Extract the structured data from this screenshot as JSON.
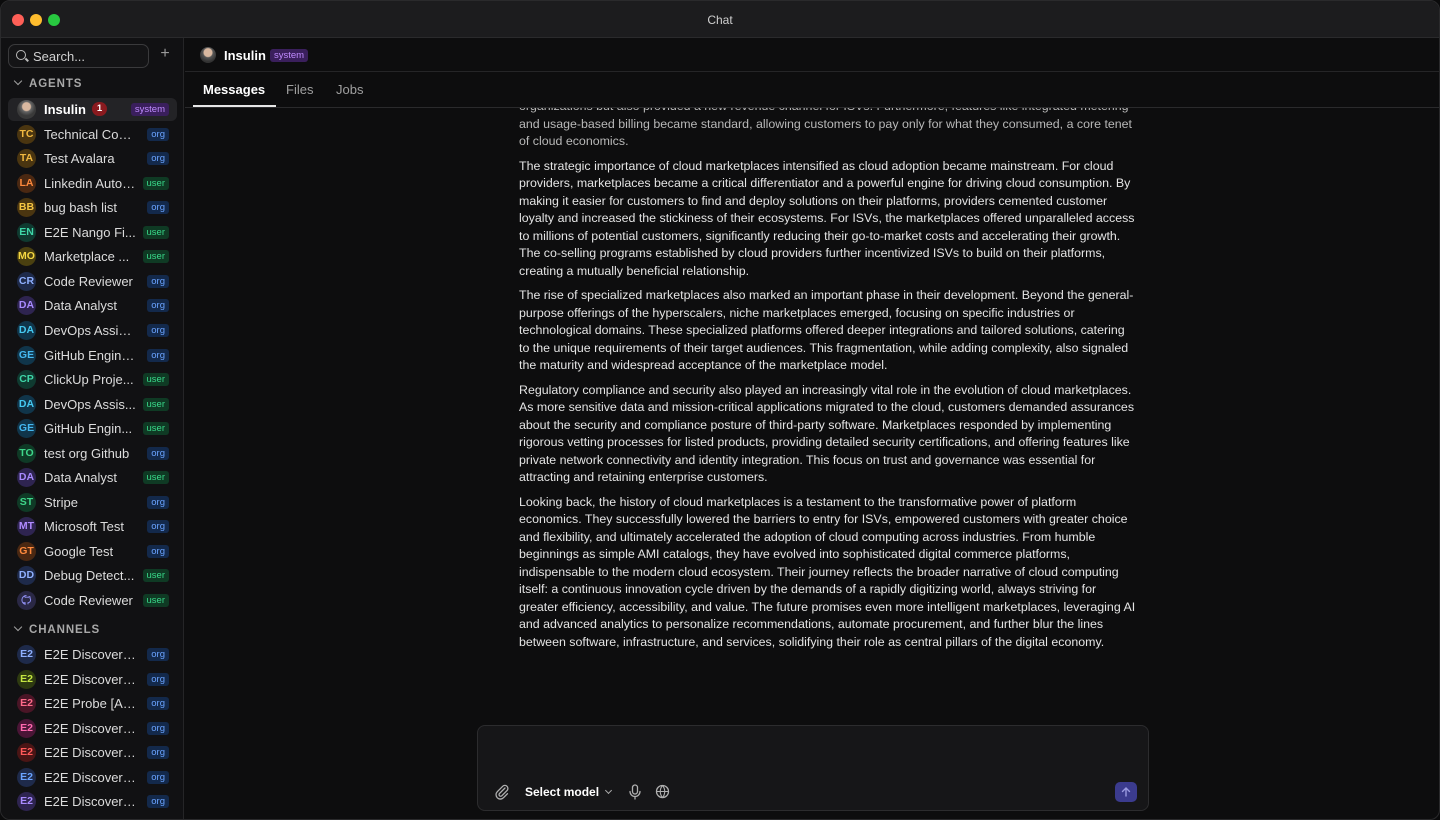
{
  "window": {
    "title": "Chat"
  },
  "sidebar": {
    "search_placeholder": "Search...",
    "agents_heading": "AGENTS",
    "channels_heading": "CHANNELS",
    "agents": [
      {
        "initials": "",
        "name": "Insulin",
        "badge": "system",
        "count": "1",
        "avatar_color": "#555555",
        "text_color": "#ffffff"
      },
      {
        "initials": "TC",
        "name": "Technical Con...",
        "badge": "org",
        "avatar_color": "#4a3510",
        "text_color": "#f0b840"
      },
      {
        "initials": "TA",
        "name": "Test Avalara",
        "badge": "org",
        "avatar_color": "#4a3510",
        "text_color": "#f0b840"
      },
      {
        "initials": "LA",
        "name": "Linkedin Auto ...",
        "badge": "user",
        "avatar_color": "#4a2812",
        "text_color": "#ff8a3d"
      },
      {
        "initials": "BB",
        "name": "bug bash list",
        "badge": "org",
        "avatar_color": "#4a3510",
        "text_color": "#f5c542"
      },
      {
        "initials": "EN",
        "name": "E2E Nango Fi...",
        "badge": "user",
        "avatar_color": "#0f3a30",
        "text_color": "#3fd6a8"
      },
      {
        "initials": "MO",
        "name": "Marketplace ...",
        "badge": "user",
        "avatar_color": "#4a4010",
        "text_color": "#f5d742"
      },
      {
        "initials": "CR",
        "name": "Code Reviewer",
        "badge": "org",
        "avatar_color": "#1e2a4a",
        "text_color": "#8fb0ff"
      },
      {
        "initials": "DA",
        "name": "Data Analyst",
        "badge": "org",
        "avatar_color": "#2e2450",
        "text_color": "#a98bff"
      },
      {
        "initials": "DA",
        "name": "DevOps Assist...",
        "badge": "org",
        "avatar_color": "#10354a",
        "text_color": "#45c8f0"
      },
      {
        "initials": "GE",
        "name": "GitHub Engineer",
        "badge": "org",
        "avatar_color": "#10354a",
        "text_color": "#45b8f0"
      },
      {
        "initials": "CP",
        "name": "ClickUp Proje...",
        "badge": "user",
        "avatar_color": "#0f3a30",
        "text_color": "#3fd6a8"
      },
      {
        "initials": "DA",
        "name": "DevOps Assis...",
        "badge": "user",
        "avatar_color": "#10354a",
        "text_color": "#45c8f0"
      },
      {
        "initials": "GE",
        "name": "GitHub Engin...",
        "badge": "user",
        "avatar_color": "#10354a",
        "text_color": "#45b8f0"
      },
      {
        "initials": "TO",
        "name": "test org Github",
        "badge": "org",
        "avatar_color": "#0f3a26",
        "text_color": "#3fd68a"
      },
      {
        "initials": "DA",
        "name": "Data Analyst",
        "badge": "user",
        "avatar_color": "#2e2450",
        "text_color": "#a98bff"
      },
      {
        "initials": "ST",
        "name": "Stripe",
        "badge": "org",
        "avatar_color": "#0f3a26",
        "text_color": "#3fd68a"
      },
      {
        "initials": "MT",
        "name": "Microsoft Test",
        "badge": "org",
        "avatar_color": "#2e2450",
        "text_color": "#b08bff"
      },
      {
        "initials": "GT",
        "name": "Google Test",
        "badge": "org",
        "avatar_color": "#4a2812",
        "text_color": "#ff8a3d"
      },
      {
        "initials": "DD",
        "name": "Debug Detect...",
        "badge": "user",
        "avatar_color": "#1e2a4a",
        "text_color": "#8fb0ff"
      },
      {
        "initials": "",
        "name": "Code Reviewer",
        "badge": "user",
        "avatar_color": "#2a2845",
        "text_color": "#8f8ff0"
      }
    ],
    "channels": [
      {
        "initials": "E2",
        "name": "E2E Discovera...",
        "badge": "org",
        "avatar_color": "#1e2a4a",
        "text_color": "#8fb0ff"
      },
      {
        "initials": "E2",
        "name": "E2E Discovera...",
        "badge": "org",
        "avatar_color": "#2e3a10",
        "text_color": "#c5e642"
      },
      {
        "initials": "E2",
        "name": "E2E Probe [AU...",
        "badge": "org",
        "avatar_color": "#4a1526",
        "text_color": "#ff6a8a"
      },
      {
        "initials": "E2",
        "name": "E2E Discovera...",
        "badge": "org",
        "avatar_color": "#4a1536",
        "text_color": "#ff6ab0"
      },
      {
        "initials": "E2",
        "name": "E2E Discovera...",
        "badge": "org",
        "avatar_color": "#4a1515",
        "text_color": "#ff5a5a"
      },
      {
        "initials": "E2",
        "name": "E2E Discovera...",
        "badge": "org",
        "avatar_color": "#1e2a4a",
        "text_color": "#6aa3ff"
      },
      {
        "initials": "E2",
        "name": "E2E Discovera...",
        "badge": "org",
        "avatar_color": "#2e2450",
        "text_color": "#a98bff"
      }
    ]
  },
  "header": {
    "agent_name": "Insulin",
    "badge": "system"
  },
  "tabs": [
    "Messages",
    "Files",
    "Jobs"
  ],
  "messages": {
    "paragraphs": [
      "organizations but also provided a new revenue channel for ISVs. Furthermore, features like integrated metering and usage-based billing became standard, allowing customers to pay only for what they consumed, a core tenet of cloud economics.",
      "The strategic importance of cloud marketplaces intensified as cloud adoption became mainstream. For cloud providers, marketplaces became a critical differentiator and a powerful engine for driving cloud consumption. By making it easier for customers to find and deploy solutions on their platforms, providers cemented customer loyalty and increased the stickiness of their ecosystems. For ISVs, the marketplaces offered unparalleled access to millions of potential customers, significantly reducing their go-to-market costs and accelerating their growth. The co-selling programs established by cloud providers further incentivized ISVs to build on their platforms, creating a mutually beneficial relationship.",
      "The rise of specialized marketplaces also marked an important phase in their development. Beyond the general-purpose offerings of the hyperscalers, niche marketplaces emerged, focusing on specific industries or technological domains. These specialized platforms offered deeper integrations and tailored solutions, catering to the unique requirements of their target audiences. This fragmentation, while adding complexity, also signaled the maturity and widespread acceptance of the marketplace model.",
      "Regulatory compliance and security also played an increasingly vital role in the evolution of cloud marketplaces. As more sensitive data and mission-critical applications migrated to the cloud, customers demanded assurances about the security and compliance posture of third-party software. Marketplaces responded by implementing rigorous vetting processes for listed products, providing detailed security certifications, and offering features like private network connectivity and identity integration. This focus on trust and governance was essential for attracting and retaining enterprise customers.",
      "Looking back, the history of cloud marketplaces is a testament to the transformative power of platform economics. They successfully lowered the barriers to entry for ISVs, empowered customers with greater choice and flexibility, and ultimately accelerated the adoption of cloud computing across industries. From humble beginnings as simple AMI catalogs, they have evolved into sophisticated digital commerce platforms, indispensable to the modern cloud ecosystem. Their journey reflects the broader narrative of cloud computing itself: a continuous innovation cycle driven by the demands of a rapidly digitizing world, always striving for greater efficiency, accessibility, and value. The future promises even more intelligent marketplaces, leveraging AI and advanced analytics to personalize recommendations, automate procurement, and further blur the lines between software, infrastructure, and services, solidifying their role as central pillars of the digital economy."
    ]
  },
  "composer": {
    "placeholder": "",
    "model_label": "Select model"
  },
  "colors": {
    "accent": "#3b3b8e",
    "badge_org": "#6aa3ff",
    "badge_user": "#39d98a",
    "badge_system": "#c08bff",
    "count_bg": "#8a1a1f"
  }
}
